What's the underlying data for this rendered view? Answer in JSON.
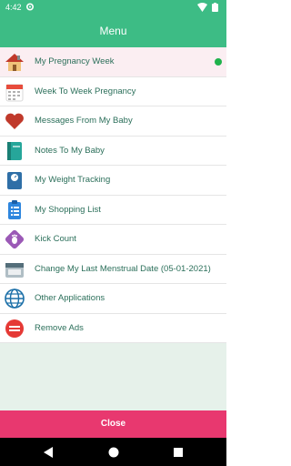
{
  "status_bar": {
    "time": "4:42",
    "icons": [
      "settings-icon",
      "wifi-icon",
      "battery-icon"
    ]
  },
  "app_bar": {
    "title": "Menu"
  },
  "menu": {
    "items": [
      {
        "label": "My Pregnancy Week",
        "icon": "house-icon",
        "selected": true
      },
      {
        "label": "Week To Week Pregnancy",
        "icon": "calendar-icon"
      },
      {
        "label": "Messages From My Baby",
        "icon": "heart-icon"
      },
      {
        "label": "Notes To My Baby",
        "icon": "notebook-icon"
      },
      {
        "label": "My Weight Tracking",
        "icon": "scale-icon"
      },
      {
        "label": "My Shopping List",
        "icon": "clipboard-icon"
      },
      {
        "label": "Kick Count",
        "icon": "footprint-icon"
      },
      {
        "label": "Change My Last Menstrual Date (05-01-2021)",
        "icon": "calendar-change-icon"
      },
      {
        "label": "Other Applications",
        "icon": "globe-icon"
      },
      {
        "label": "Remove Ads",
        "icon": "no-ads-icon"
      }
    ]
  },
  "close_button": {
    "label": "Close"
  },
  "colors": {
    "primary": "#3dbc85",
    "label": "#2b6f5a",
    "close": "#e8386f",
    "selected_bg": "#fbeef2",
    "active_dot": "#1fb24c"
  },
  "nav_bar": {
    "buttons": [
      "back-icon",
      "home-icon",
      "recents-icon"
    ]
  }
}
